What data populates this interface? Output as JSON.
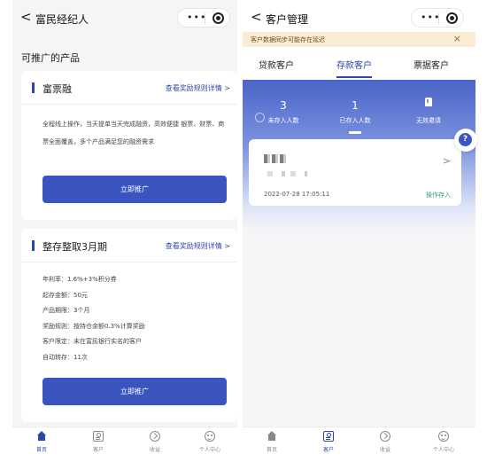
{
  "left": {
    "nav_title": "富民经纪人",
    "section_title": "可推广的产品",
    "product1": {
      "name": "富票融",
      "link": "查看奖励规则详情 >",
      "desc": "全程线上操作，当天提单当天完成融资，高效便捷 银票、财票、商票全面覆盖，多个产品满足您的融资需求",
      "button": "立即推广"
    },
    "product2": {
      "name": "整存整取3月期",
      "link": "查看奖励规则详情 >",
      "details": [
        "年利率：1.6%+3%积分券",
        "起存金额：50元",
        "产品期限：3个月",
        "奖励规则：按持仓余额0.3%计算奖励",
        "客户限定：未在富民银行实名的客户",
        "自动转存：11次"
      ],
      "button": "立即推广"
    },
    "tabbar": [
      "首页",
      "客户",
      "收益",
      "个人中心"
    ],
    "active_tab": "首页"
  },
  "right": {
    "nav_title": "客户管理",
    "notice": "客户数据同步可能存在延迟",
    "notice_close": "×",
    "tabs": [
      "贷款客户",
      "存款客户",
      "票据客户"
    ],
    "active_tab": "存款客户",
    "stats": [
      {
        "value": "3",
        "label": "未存入人数"
      },
      {
        "value": "1",
        "label": "已存入人数"
      },
      {
        "value": "",
        "label": "无效邀请"
      }
    ],
    "customer": {
      "time": "2022-07-28 17:05:11",
      "action": "操作存入",
      "chevron": ">"
    },
    "help": "?",
    "tabbar": [
      "首页",
      "客户",
      "收益",
      "个人中心"
    ],
    "active_tabbar": "客户"
  },
  "colors": {
    "accent": "#3a55bf",
    "notice_bg": "#fbecd4",
    "success": "#2f9e6b"
  }
}
